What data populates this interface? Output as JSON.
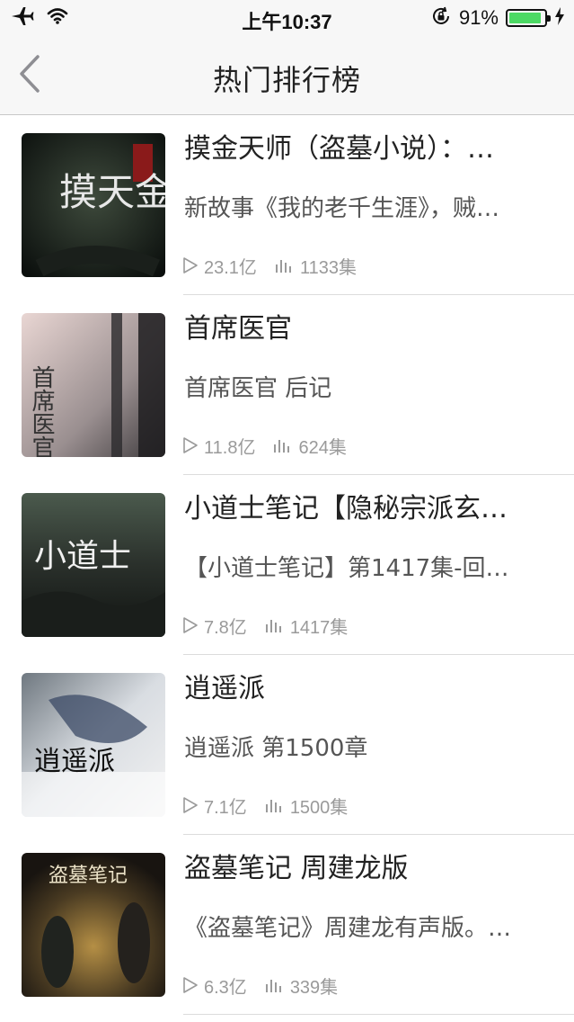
{
  "status_bar": {
    "time": "上午10:37",
    "battery_percent": "91%",
    "battery_level": 0.91,
    "icons": [
      "airplane-icon",
      "wifi-icon",
      "rotation-lock-icon",
      "battery-icon",
      "charging-icon"
    ]
  },
  "nav": {
    "title": "热门排行榜",
    "back_icon": "chevron-left-icon"
  },
  "colors": {
    "battery_fill": "#4cd964",
    "meta_gray": "#9a9a9a",
    "separator": "#dcdcdc"
  },
  "list": [
    {
      "title": "摸金天师（盗墓小说）：…",
      "desc": "新故事《我的老千生涯》，贼…",
      "plays": "23.1亿",
      "episodes": "1133集",
      "cover_text": "摸天金师"
    },
    {
      "title": "首席医官",
      "desc": "首席医官 后记",
      "plays": "11.8亿",
      "episodes": "624集",
      "cover_text": "首席医官"
    },
    {
      "title": "小道士笔记【隐秘宗派玄…",
      "desc": "【小道士笔记】第1417集-回…",
      "plays": "7.8亿",
      "episodes": "1417集",
      "cover_text": "小道士"
    },
    {
      "title": "逍遥派",
      "desc": "逍遥派 第1500章",
      "plays": "7.1亿",
      "episodes": "1500集",
      "cover_text": "逍遥派"
    },
    {
      "title": "盗墓笔记 周建龙版",
      "desc": "《盗墓笔记》周建龙有声版。…",
      "plays": "6.3亿",
      "episodes": "339集",
      "cover_text": "盗墓笔记"
    }
  ]
}
